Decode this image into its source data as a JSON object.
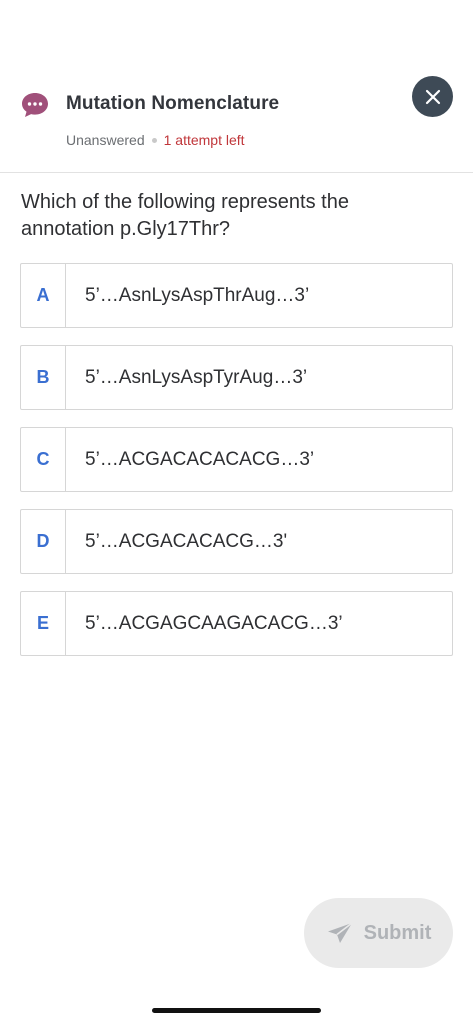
{
  "header": {
    "title": "Mutation Nomenclature",
    "status": "Unanswered",
    "attempts": "1 attempt left",
    "icons": {
      "chat": "chat-bubble-icon",
      "close": "close-icon"
    },
    "colors": {
      "chat_icon": "#a0507a",
      "attempts_text": "#c0363a",
      "close_button": "#3e4a56"
    }
  },
  "question": {
    "text": "Which of the following represents the annotation p.Gly17Thr?"
  },
  "options": [
    {
      "letter": "A",
      "text": "5’…AsnLysAspThrAug…3’"
    },
    {
      "letter": "B",
      "text": "5’…AsnLysAspTyrAug…3’"
    },
    {
      "letter": "C",
      "text": "5’…ACGACACACACG…3’"
    },
    {
      "letter": "D",
      "text": "5’…ACGACACACG…3'"
    },
    {
      "letter": "E",
      "text": "5’…ACGAGCAAGACACG…3’"
    }
  ],
  "footer": {
    "submit_label": "Submit",
    "submit_icon": "send-icon"
  }
}
